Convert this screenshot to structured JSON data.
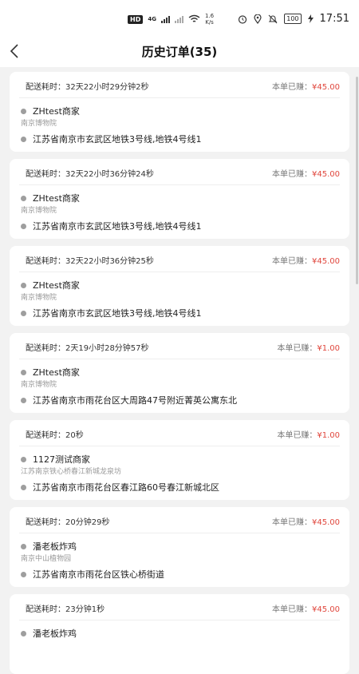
{
  "status_bar": {
    "hd": "HD",
    "sig1": "4G",
    "speed_val": "1.6",
    "speed_unit": "K/s",
    "battery": "100",
    "time": "17:51"
  },
  "header": {
    "title": "历史订单(35)"
  },
  "orders": [
    {
      "duration": "配送耗时：32天22小时29分钟2秒",
      "earned_label": "本单已赚：",
      "earned": "¥45.00",
      "merchant": "ZHtest商家",
      "merchant_sub": "南京博物院",
      "address": "江苏省南京市玄武区地铁3号线,地铁4号线1"
    },
    {
      "duration": "配送耗时：32天22小时36分钟24秒",
      "earned_label": "本单已赚：",
      "earned": "¥45.00",
      "merchant": "ZHtest商家",
      "merchant_sub": "南京博物院",
      "address": "江苏省南京市玄武区地铁3号线,地铁4号线1"
    },
    {
      "duration": "配送耗时：32天22小时36分钟25秒",
      "earned_label": "本单已赚：",
      "earned": "¥45.00",
      "merchant": "ZHtest商家",
      "merchant_sub": "南京博物院",
      "address": "江苏省南京市玄武区地铁3号线,地铁4号线1"
    },
    {
      "duration": "配送耗时：2天19小时28分钟57秒",
      "earned_label": "本单已赚：",
      "earned": "¥1.00",
      "merchant": "ZHtest商家",
      "merchant_sub": "南京博物院",
      "address": "江苏省南京市雨花台区大周路47号附近菁英公寓东北"
    },
    {
      "duration": "配送耗时：20秒",
      "earned_label": "本单已赚：",
      "earned": "¥1.00",
      "merchant": "1127测试商家",
      "merchant_sub": "江苏南京铁心桥春江新城龙泉坊",
      "address": "江苏省南京市雨花台区春江路60号春江新城北区"
    },
    {
      "duration": "配送耗时：20分钟29秒",
      "earned_label": "本单已赚：",
      "earned": "¥45.00",
      "merchant": "潘老板炸鸡",
      "merchant_sub": "南京中山植物园",
      "address": "江苏省南京市雨花台区铁心桥街道"
    },
    {
      "duration": "配送耗时：23分钟1秒",
      "earned_label": "本单已赚：",
      "earned": "¥45.00",
      "merchant": "潘老板炸鸡",
      "merchant_sub": "",
      "address": ""
    }
  ]
}
